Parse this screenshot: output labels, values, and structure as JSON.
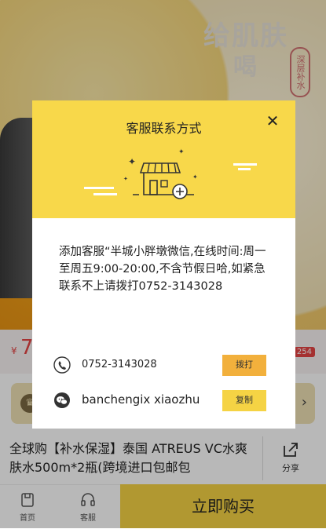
{
  "background": {
    "hero_heading_line1": "给肌肤",
    "hero_heading_line2": "喝",
    "hero_seal_text": "深层补水",
    "price_currency": "¥",
    "price_value": "7",
    "price_badge": "254",
    "product_title": "全球购【补水保湿】泰国 ATREUS VC水爽肤水500m*2瓶(跨境进口包邮包",
    "share_label": "分享"
  },
  "bottom_nav": {
    "home_label": "首页",
    "service_label": "客服",
    "buy_label": "立即购买"
  },
  "modal": {
    "title": "客服联系方式",
    "close_symbol": "✕",
    "message": "添加客服“半城小胖墩微信,在线时间:周一至周五9:00-20:00,不含节假日哈,如紧急联系不上请拨打0752-3143028",
    "phone": "0752-3143028",
    "call_label": "拨打",
    "wechat_id": "banchengix xiaozhu",
    "copy_label": "复制"
  },
  "colors": {
    "accent_yellow": "#f8d84a",
    "call_button": "#f2b03c",
    "buy_button": "#f5d344",
    "price_red": "#e54545"
  },
  "icons": [
    "phone-icon",
    "wechat-icon",
    "shop-icon",
    "share-icon",
    "home-icon",
    "headset-icon",
    "crown-icon"
  ]
}
